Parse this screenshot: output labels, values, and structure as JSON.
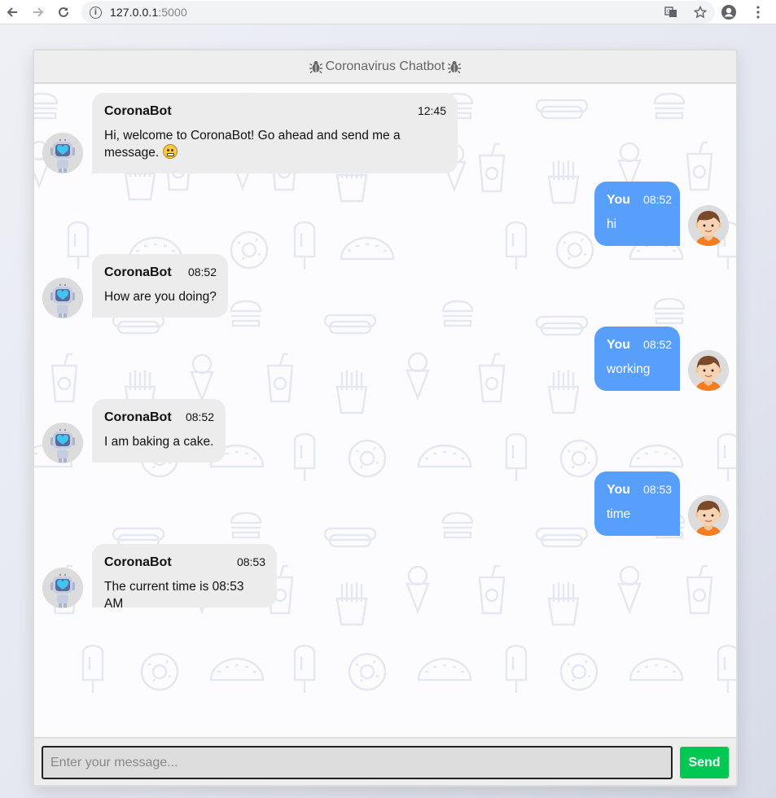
{
  "browser": {
    "url_host": "127.0.0.1",
    "url_port": ":5000",
    "back_icon": "arrow-left-icon",
    "forward_icon": "arrow-right-icon",
    "reload_icon": "reload-icon"
  },
  "chat": {
    "title": "Coronavirus Chatbot",
    "title_icon": "bug-icon"
  },
  "messages": [
    {
      "side": "left",
      "name": "CoronaBot",
      "time": "12:45",
      "text": "Hi, welcome to CoronaBot! Go ahead and send me a message.",
      "emoji": true
    },
    {
      "side": "right",
      "name": "You",
      "time": "08:52",
      "text": "hi"
    },
    {
      "side": "left",
      "name": "CoronaBot",
      "time": "08:52",
      "text": "How are you doing?"
    },
    {
      "side": "right",
      "name": "You",
      "time": "08:52",
      "text": "working"
    },
    {
      "side": "left",
      "name": "CoronaBot",
      "time": "08:52",
      "text": "I am baking a cake."
    },
    {
      "side": "right",
      "name": "You",
      "time": "08:53",
      "text": "time"
    },
    {
      "side": "left",
      "name": "CoronaBot",
      "time": "08:53",
      "text": "The current time is 08:53 AM"
    }
  ],
  "input": {
    "placeholder": "Enter your message...",
    "send_label": "Send"
  },
  "colors": {
    "bot_bubble": "#ececec",
    "user_bubble": "#579ffb",
    "send_button": "#00c853"
  }
}
